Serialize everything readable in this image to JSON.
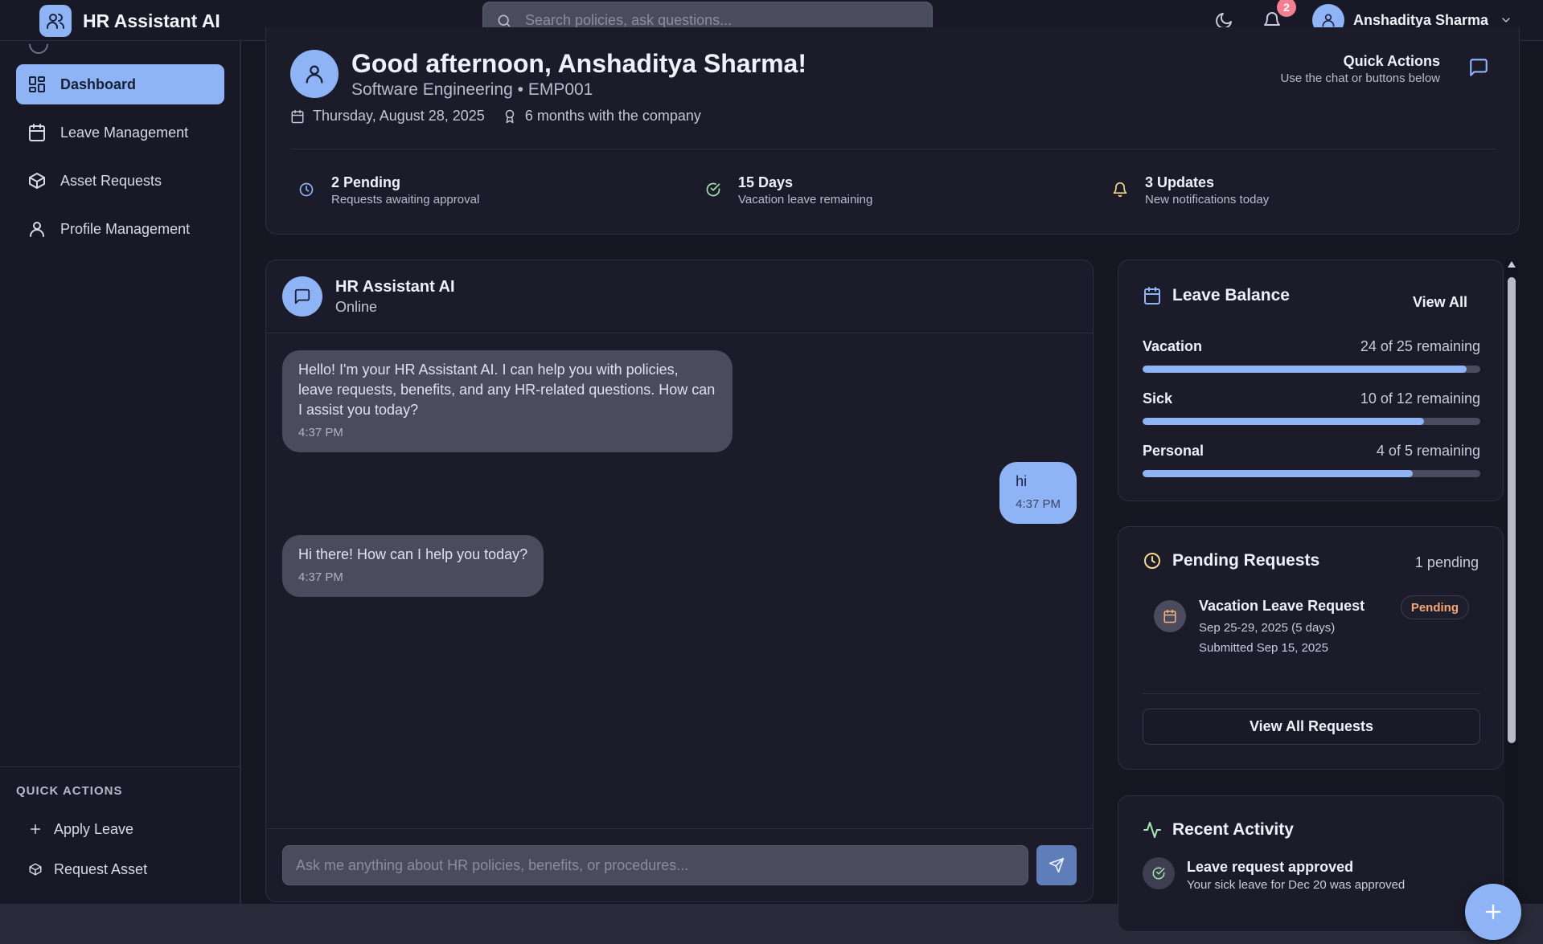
{
  "app": {
    "title": "HR Assistant AI"
  },
  "colors": {
    "accent": "#8fb4f6",
    "background": "#171724",
    "surface": "#1b1b2a",
    "pending": "#f5a77a",
    "success": "#a8e6b3",
    "badge": "#f47f93"
  },
  "topbar": {
    "search_placeholder": "Search policies, ask questions...",
    "notification_count": "2",
    "user_name": "Anshaditya Sharma",
    "icons": [
      "users-icon",
      "search-icon",
      "moon-icon",
      "bell-icon",
      "user-icon",
      "chevron-down-icon"
    ]
  },
  "sidebar": {
    "items": [
      {
        "label": "Dashboard",
        "icon": "dashboard-icon",
        "active": true
      },
      {
        "label": "Leave Management",
        "icon": "calendar-icon",
        "active": false
      },
      {
        "label": "Asset Requests",
        "icon": "package-icon",
        "active": false
      },
      {
        "label": "Profile Management",
        "icon": "user-icon",
        "active": false
      }
    ],
    "quick_actions_title": "QUICK ACTIONS",
    "quick_actions": [
      {
        "label": "Apply Leave",
        "icon": "plus-icon"
      },
      {
        "label": "Request Asset",
        "icon": "package-icon"
      }
    ]
  },
  "welcome": {
    "greeting": "Good afternoon, Anshaditya Sharma!",
    "department": "Software Engineering • EMP001",
    "date": "Thursday, August 28, 2025",
    "tenure": "6 months with the company",
    "quick_actions_title": "Quick Actions",
    "quick_actions_subtitle": "Use the chat or buttons below",
    "stats": [
      {
        "title": "2 Pending",
        "subtitle": "Requests awaiting approval",
        "icon": "clock-icon"
      },
      {
        "title": "15 Days",
        "subtitle": "Vacation leave remaining",
        "icon": "check-circle-icon"
      },
      {
        "title": "3 Updates",
        "subtitle": "New notifications today",
        "icon": "bell-icon"
      }
    ]
  },
  "chat": {
    "title": "HR Assistant AI",
    "status": "Online",
    "messages": [
      {
        "sender": "bot",
        "text": "Hello! I'm your HR Assistant AI. I can help you with policies, leave requests, benefits, and any HR-related questions. How can I assist you today?",
        "time": "4:37 PM"
      },
      {
        "sender": "user",
        "text": "hi",
        "time": "4:37 PM"
      },
      {
        "sender": "bot",
        "text": "Hi there! How can I help you today?",
        "time": "4:37 PM"
      }
    ],
    "input_placeholder": "Ask me anything about HR policies, benefits, or procedures..."
  },
  "leave_balance": {
    "title": "Leave Balance",
    "view_all": "View All",
    "items": [
      {
        "type": "Vacation",
        "remaining_text": "24 of 25 remaining",
        "fraction": 0.96
      },
      {
        "type": "Sick",
        "remaining_text": "10 of 12 remaining",
        "fraction": 0.833
      },
      {
        "type": "Personal",
        "remaining_text": "4 of 5 remaining",
        "fraction": 0.8
      }
    ]
  },
  "pending_requests": {
    "title": "Pending Requests",
    "count_text": "1 pending",
    "request": {
      "title": "Vacation Leave Request",
      "dates": "Sep 25-29, 2025 (5 days)",
      "submitted": "Submitted Sep 15, 2025",
      "status": "Pending"
    },
    "view_all_button": "View All Requests"
  },
  "recent_activity": {
    "title": "Recent Activity",
    "item": {
      "title": "Leave request approved",
      "subtitle": "Your sick leave for Dec 20 was approved"
    }
  }
}
